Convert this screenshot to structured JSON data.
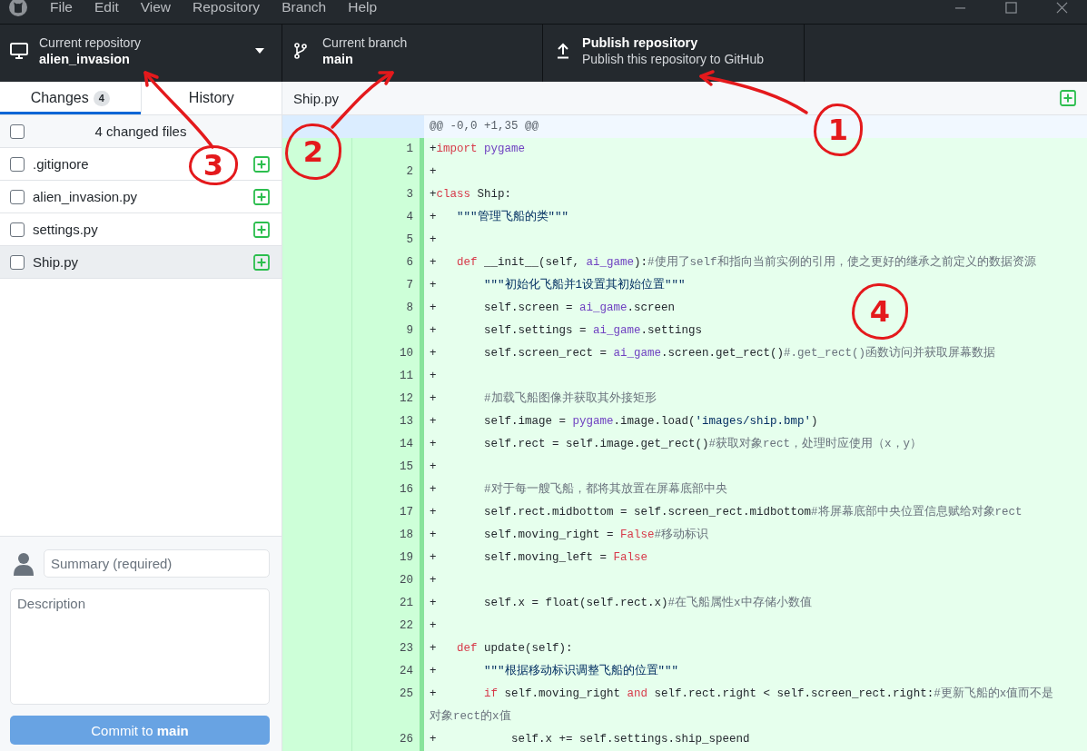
{
  "title_bar": {
    "menu": [
      "File",
      "Edit",
      "View",
      "Repository",
      "Branch",
      "Help"
    ]
  },
  "toolbar": {
    "repository": {
      "label": "Current repository",
      "value": "alien_invasion"
    },
    "branch": {
      "label": "Current branch",
      "value": "main"
    },
    "publish": {
      "title": "Publish repository",
      "description": "Publish this repository to GitHub"
    }
  },
  "sidebar": {
    "tabs": [
      {
        "label": "Changes",
        "count": "4",
        "selected": true
      },
      {
        "label": "History",
        "selected": false
      }
    ],
    "header": {
      "label": "4 changed files",
      "checked": false
    },
    "files": [
      {
        "name": ".gitignore",
        "added": true,
        "checked": false,
        "selected": false
      },
      {
        "name": "alien_invasion.py",
        "added": true,
        "checked": false,
        "selected": false
      },
      {
        "name": "settings.py",
        "added": true,
        "checked": false,
        "selected": false
      },
      {
        "name": "Ship.py",
        "added": true,
        "checked": false,
        "selected": true
      }
    ],
    "commit": {
      "summary": {
        "placeholder": "Summary (required)"
      },
      "description": {
        "placeholder": "Description"
      },
      "button": {
        "label": "Commit to **main**",
        "disabled": true
      }
    }
  },
  "diff": {
    "file": "Ship.py",
    "added": true,
    "hunk": "@@ -0,0 +1,35 @@",
    "lines": [
      {
        "number": "1",
        "tokens": [
          {
            "kind": "text",
            "text": "+"
          },
          {
            "kind": "keyword",
            "text": "import"
          },
          {
            "kind": "name",
            "text": " pygame"
          }
        ]
      },
      {
        "number": "2",
        "tokens": [
          {
            "kind": "text",
            "text": "+"
          }
        ]
      },
      {
        "number": "3",
        "tokens": [
          {
            "kind": "text",
            "text": "+"
          },
          {
            "kind": "keyword",
            "text": "class"
          },
          {
            "kind": "text",
            "text": " Ship:"
          }
        ]
      },
      {
        "number": "4",
        "tokens": [
          {
            "kind": "text",
            "text": "+   "
          },
          {
            "kind": "string",
            "text": "\"\"\"管理飞船的类\"\"\""
          }
        ]
      },
      {
        "number": "5",
        "tokens": [
          {
            "kind": "text",
            "text": "+"
          }
        ]
      },
      {
        "number": "6",
        "tokens": [
          {
            "kind": "text",
            "text": "+   "
          },
          {
            "kind": "keyword",
            "text": "def"
          },
          {
            "kind": "text",
            "text": " __init__(self, "
          },
          {
            "kind": "name",
            "text": "ai_game"
          },
          {
            "kind": "text",
            "text": "):"
          },
          {
            "kind": "comment",
            "text": "#使用了self和指向当前实例的引用，使之更好的继承之前定义的数据资源"
          }
        ]
      },
      {
        "number": "7",
        "tokens": [
          {
            "kind": "text",
            "text": "+       "
          },
          {
            "kind": "string",
            "text": "\"\"\"初始化飞船并1设置其初始位置\"\"\""
          }
        ]
      },
      {
        "number": "8",
        "tokens": [
          {
            "kind": "text",
            "text": "+       self.screen = "
          },
          {
            "kind": "name",
            "text": "ai_game"
          },
          {
            "kind": "text",
            "text": ".screen"
          }
        ]
      },
      {
        "number": "9",
        "tokens": [
          {
            "kind": "text",
            "text": "+       self.settings = "
          },
          {
            "kind": "name",
            "text": "ai_game"
          },
          {
            "kind": "text",
            "text": ".settings"
          }
        ]
      },
      {
        "number": "10",
        "tokens": [
          {
            "kind": "text",
            "text": "+       self.screen_rect = "
          },
          {
            "kind": "name",
            "text": "ai_game"
          },
          {
            "kind": "text",
            "text": ".screen.get_rect()"
          },
          {
            "kind": "comment",
            "text": "#.get_rect()函数访问并获取屏幕数据"
          }
        ]
      },
      {
        "number": "11",
        "tokens": [
          {
            "kind": "text",
            "text": "+"
          }
        ]
      },
      {
        "number": "12",
        "tokens": [
          {
            "kind": "text",
            "text": "+       "
          },
          {
            "kind": "comment",
            "text": "#加载飞船图像并获取其外接矩形"
          }
        ]
      },
      {
        "number": "13",
        "tokens": [
          {
            "kind": "text",
            "text": "+       self.image = "
          },
          {
            "kind": "name",
            "text": "pygame"
          },
          {
            "kind": "text",
            "text": ".image.load("
          },
          {
            "kind": "string",
            "text": "'images/ship.bmp'"
          },
          {
            "kind": "text",
            "text": ")"
          }
        ]
      },
      {
        "number": "14",
        "tokens": [
          {
            "kind": "text",
            "text": "+       self.rect = self.image.get_rect()"
          },
          {
            "kind": "comment",
            "text": "#获取对象rect，处理时应使用（x，y）"
          }
        ]
      },
      {
        "number": "15",
        "tokens": [
          {
            "kind": "text",
            "text": "+"
          }
        ]
      },
      {
        "number": "16",
        "tokens": [
          {
            "kind": "text",
            "text": "+       "
          },
          {
            "kind": "comment",
            "text": "#对于每一艘飞船，都将其放置在屏幕底部中央"
          }
        ]
      },
      {
        "number": "17",
        "tokens": [
          {
            "kind": "text",
            "text": "+       self.rect.midbottom = self.screen_rect.midbottom"
          },
          {
            "kind": "comment",
            "text": "#将屏幕底部中央位置信息赋给对象rect"
          }
        ]
      },
      {
        "number": "18",
        "tokens": [
          {
            "kind": "text",
            "text": "+       self.moving_right = "
          },
          {
            "kind": "keyword",
            "text": "False"
          },
          {
            "kind": "comment",
            "text": "#移动标识"
          }
        ]
      },
      {
        "number": "19",
        "tokens": [
          {
            "kind": "text",
            "text": "+       self.moving_left = "
          },
          {
            "kind": "keyword",
            "text": "False"
          }
        ]
      },
      {
        "number": "20",
        "tokens": [
          {
            "kind": "text",
            "text": "+"
          }
        ]
      },
      {
        "number": "21",
        "tokens": [
          {
            "kind": "text",
            "text": "+       self.x = float(self.rect.x)"
          },
          {
            "kind": "comment",
            "text": "#在飞船属性x中存储小数值"
          }
        ]
      },
      {
        "number": "22",
        "tokens": [
          {
            "kind": "text",
            "text": "+"
          }
        ]
      },
      {
        "number": "23",
        "tokens": [
          {
            "kind": "text",
            "text": "+   "
          },
          {
            "kind": "keyword",
            "text": "def"
          },
          {
            "kind": "text",
            "text": " update(self):"
          }
        ]
      },
      {
        "number": "24",
        "tokens": [
          {
            "kind": "text",
            "text": "+       "
          },
          {
            "kind": "string",
            "text": "\"\"\"根据移动标识调整飞船的位置\"\"\""
          }
        ]
      },
      {
        "number": "25",
        "tokens": [
          {
            "kind": "text",
            "text": "+       "
          },
          {
            "kind": "keyword",
            "text": "if"
          },
          {
            "kind": "text",
            "text": " self.moving_right "
          },
          {
            "kind": "keyword",
            "text": "and"
          },
          {
            "kind": "text",
            "text": " self.rect.right < self.screen_rect.right:"
          },
          {
            "kind": "comment",
            "text": "#更新飞船的x值而不是对象rect的x值"
          }
        ]
      },
      {
        "number": "26",
        "tokens": [
          {
            "kind": "text",
            "text": "+           self.x += self.settings.ship_speend"
          }
        ]
      }
    ]
  },
  "annotations": [
    {
      "label": "1"
    },
    {
      "label": "2"
    },
    {
      "label": "3"
    },
    {
      "label": "4"
    }
  ]
}
